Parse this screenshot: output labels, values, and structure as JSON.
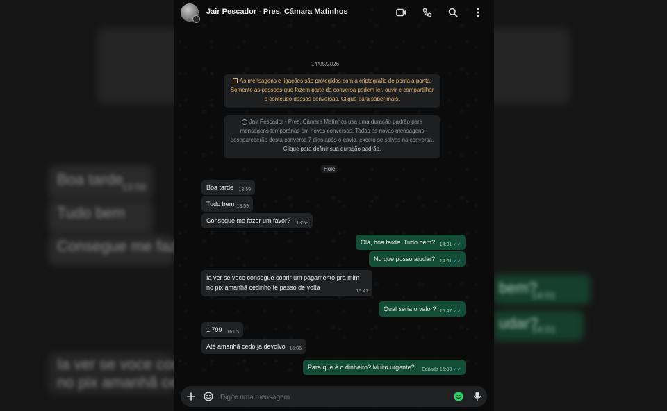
{
  "header": {
    "contact_name": "Jair Pescador - Pres. Câmara Matinhos",
    "icons": [
      "video-call-icon",
      "phone-icon",
      "search-icon",
      "more-options-icon"
    ]
  },
  "chat": {
    "date_label": "14/05/2026",
    "encryption_notice_lines": [
      "As mensagens e ligações são protegidas com a criptografia de ponta a ponta.",
      "Somente as pessoas que fazem parte da conversa podem ler, ouvir e compartilhar",
      "o conteúdo dessas conversas. Clique para saber mais."
    ],
    "timer_notice_lines": [
      "Jair Pescador - Pres. Câmara Matinhos usa uma duração padrão para",
      "mensagens temporárias em novas conversas. Todas as novas mensagens",
      "desaparecerão desta conversa 7 dias após o envio, exceto se salvas na conversa."
    ],
    "timer_notice_link": "Clique para definir sua duração padrão.",
    "today_label": "Hoje",
    "messages": [
      {
        "dir": "in",
        "text": "Boa tarde",
        "time": "13:59"
      },
      {
        "dir": "in",
        "text": "Tudo bem",
        "time": "13:59"
      },
      {
        "dir": "in",
        "text": "Consegue me fazer um favor?",
        "time": "13:59"
      },
      {
        "dir": "out",
        "text": "Olá, boa tarde. Tudo bem?",
        "time": "14:01"
      },
      {
        "dir": "out",
        "text": "No que posso ajudar?",
        "time": "14:01"
      },
      {
        "dir": "in",
        "text_lines": [
          "Ia ver se voce consegue cobrir um pagamento pra mim",
          "no pix amanhã cedinho te passo de volta"
        ],
        "time": "15:41"
      },
      {
        "dir": "out",
        "text": "Qual seria o valor?",
        "time": "15:47"
      },
      {
        "dir": "in",
        "text": "1.799",
        "time": "16:05"
      },
      {
        "dir": "in",
        "text": "Até amanhã cedo ja devolvo",
        "time": "16:05"
      },
      {
        "dir": "out",
        "text": "Para que é o dinheiro? Muito urgente?",
        "time": "Editada 16:08"
      }
    ]
  },
  "composer": {
    "placeholder": "Digite uma mensagem"
  },
  "background_blur_text": [
    "Boa tarde",
    "13:59",
    "Tudo bem",
    "Consegue me fazer",
    "Ia ver se voce conse",
    "no pix amanhã cedi",
    "bem?",
    "14:01",
    "udar?",
    "14:01"
  ],
  "colors": {
    "incoming_bubble": "#202223",
    "outgoing_bubble": "#144d37",
    "read_ticks": "#53bdeb",
    "notice_accent": "#e9b46a",
    "send_accent": "#25d366"
  }
}
